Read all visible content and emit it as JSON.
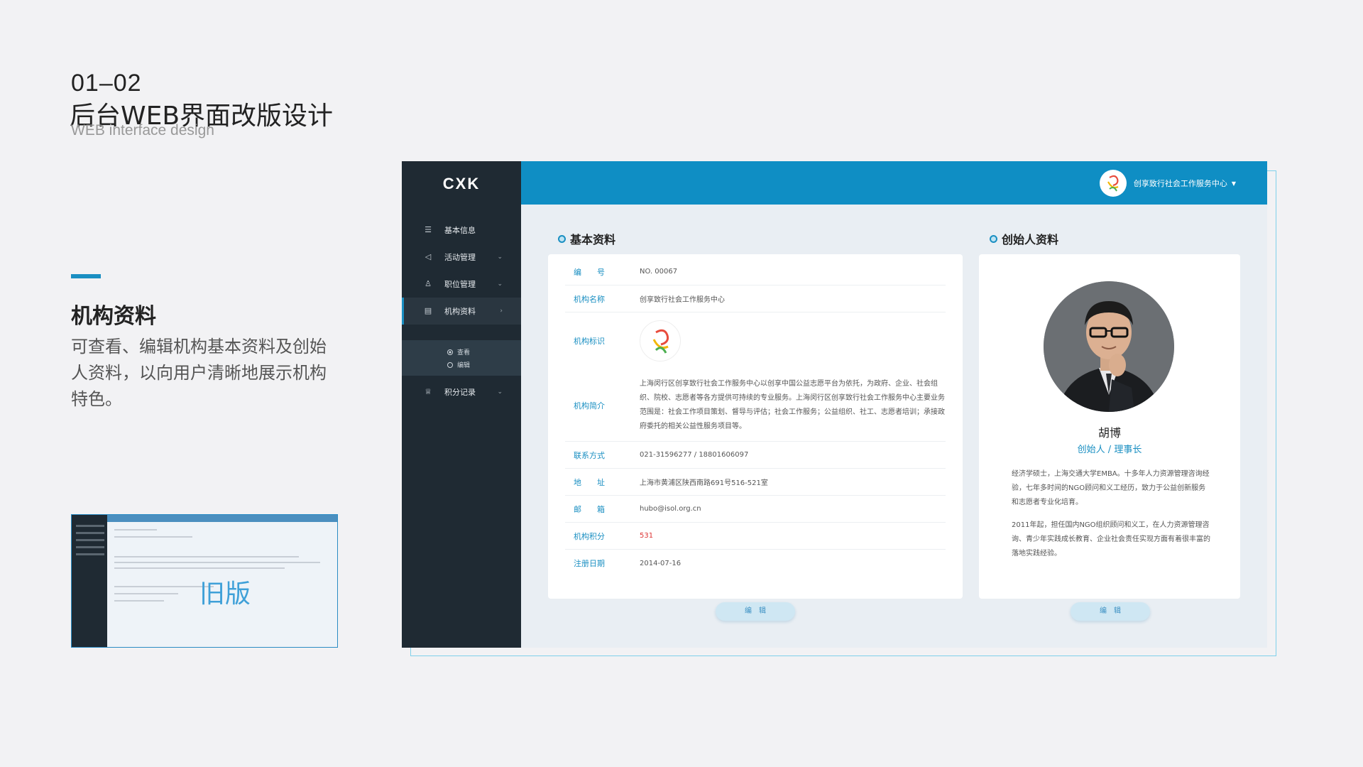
{
  "presentation": {
    "section_number": "01–02",
    "section_title": "后台WEB界面改版设计",
    "section_subtitle": "WEB interface design",
    "feature_title": "机构资料",
    "feature_description": "可查看、编辑机构基本资料及创始人资料，以向用户清晰地展示机构特色。",
    "old_version_label": "旧版",
    "accent_color": "#1a8fc2"
  },
  "app": {
    "logo": "CXK",
    "user_org_name": "创享致行社会工作服务中心",
    "sidebar": {
      "items": [
        {
          "icon": "list-icon",
          "label": "基本信息",
          "has_caret": false
        },
        {
          "icon": "megaphone-icon",
          "label": "活动管理",
          "has_caret": true
        },
        {
          "icon": "people-icon",
          "label": "职位管理",
          "has_caret": true
        },
        {
          "icon": "profile-card-icon",
          "label": "机构资料",
          "has_caret": true,
          "active": true
        },
        {
          "icon": "trophy-icon",
          "label": "积分记录",
          "has_caret": true
        }
      ],
      "sub_items": [
        {
          "label": "查看",
          "selected": true
        },
        {
          "label": "编辑",
          "selected": false
        }
      ]
    },
    "basic_info": {
      "heading": "基本资料",
      "rows": [
        {
          "label": "编　　号",
          "value": "NO. 00067"
        },
        {
          "label": "机构名称",
          "value": "创享致行社会工作服务中心"
        },
        {
          "label": "机构标识",
          "value": ""
        },
        {
          "label": "机构简介",
          "value": "上海闵行区创享致行社会工作服务中心以创享中国公益志愿平台为依托，为政府、企业、社会组织、院校、志愿者等各方提供可持续的专业服务。上海闵行区创享致行社会工作服务中心主要业务范围是：社会工作项目策划、督导与评估；社会工作服务；公益组织、社工、志愿者培训；承接政府委托的相关公益性服务项目等。"
        },
        {
          "label": "联系方式",
          "value": "021-31596277  /  18801606097"
        },
        {
          "label": "地　　址",
          "value": "上海市黄浦区陕西南路691号516-521室"
        },
        {
          "label": "邮　　箱",
          "value": "hubo@isol.org.cn"
        },
        {
          "label": "机构积分",
          "value": "531"
        },
        {
          "label": "注册日期",
          "value": "2014-07-16"
        }
      ],
      "edit_button": "编　辑"
    },
    "founder": {
      "heading": "创始人资料",
      "name": "胡博",
      "role": "创始人 / 理事长",
      "bio_1": "经济学硕士，上海交通大学EMBA。十多年人力资源管理咨询经验，七年多时间的NGO顾问和义工经历，致力于公益创新服务和志愿者专业化培育。",
      "bio_2": "2011年起，担任国内NGO组织顾问和义工，在人力资源管理咨询、青少年实践成长教育、企业社会责任实现方面有着很丰富的落地实践经验。",
      "edit_button": "编　辑"
    }
  }
}
